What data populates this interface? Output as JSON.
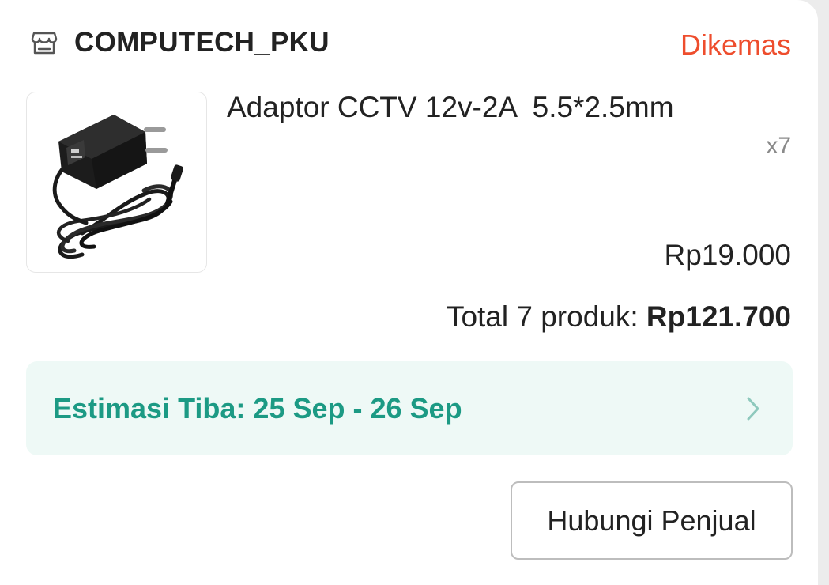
{
  "shop": {
    "icon": "storefront-icon",
    "name": "COMPUTECH_PKU",
    "status": "Dikemas"
  },
  "product": {
    "image_icon": "power-adapter-image",
    "title": "Adaptor CCTV 12v-2A  5.5*2.5mm",
    "quantity": "x7",
    "price": "Rp19.000"
  },
  "total": {
    "label": "Total 7 produk: ",
    "amount": "Rp121.700"
  },
  "delivery": {
    "estimate": "Estimasi Tiba: 25 Sep - 26 Sep",
    "chevron_icon": "chevron-right-icon"
  },
  "actions": {
    "contact_seller_label": "Hubungi Penjual"
  },
  "colors": {
    "status": "#ee4d2d",
    "delivery_text": "#1c9a84",
    "delivery_bg": "#eef9f6"
  }
}
